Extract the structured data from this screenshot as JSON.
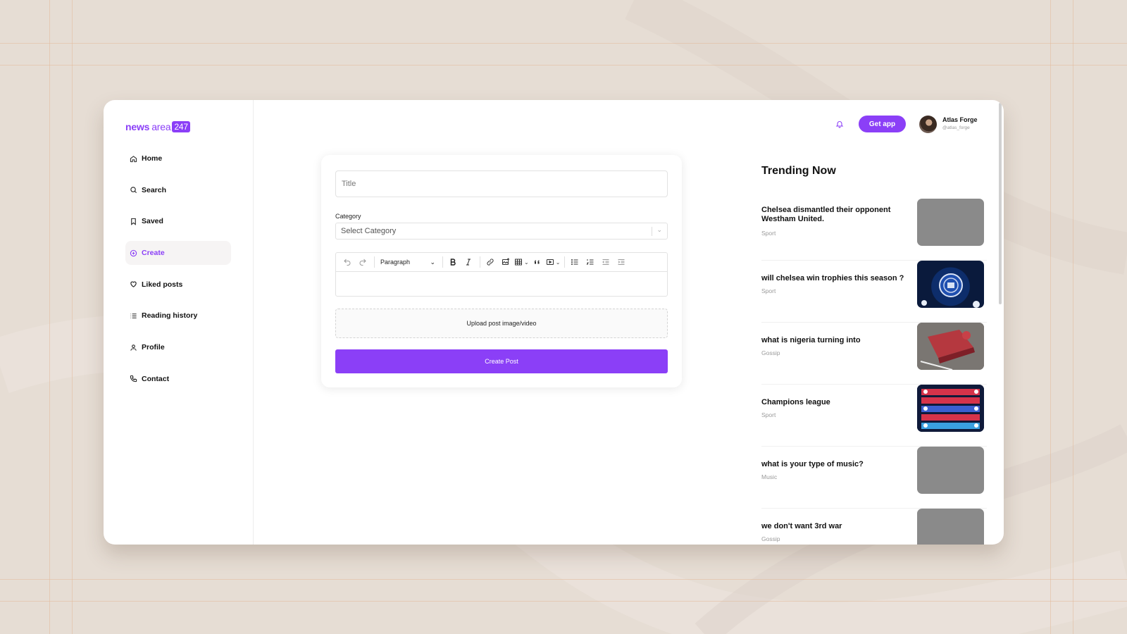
{
  "brand": {
    "part1": "news",
    "part2": "area",
    "badge": "247"
  },
  "nav": [
    {
      "label": "Home",
      "icon": "home-icon"
    },
    {
      "label": "Search",
      "icon": "search-icon"
    },
    {
      "label": "Saved",
      "icon": "bookmark-icon"
    },
    {
      "label": "Create",
      "icon": "plus-circle-icon",
      "active": true
    },
    {
      "label": "Liked posts",
      "icon": "heart-icon"
    },
    {
      "label": "Reading history",
      "icon": "list-icon"
    },
    {
      "label": "Profile",
      "icon": "user-icon"
    },
    {
      "label": "Contact",
      "icon": "phone-icon"
    }
  ],
  "topbar": {
    "get_app": "Get app",
    "user_name": "Atlas Forge",
    "user_handle": "@atlas_forge"
  },
  "form": {
    "title_placeholder": "Title",
    "category_label": "Category",
    "category_placeholder": "Select Category",
    "block_format": "Paragraph",
    "upload_label": "Upload post image/video",
    "submit_label": "Create Post"
  },
  "trending": {
    "title": "Trending Now",
    "items": [
      {
        "headline": "Chelsea dismantled their opponent Westham United.",
        "category": "Sport",
        "thumb": "placeholder"
      },
      {
        "headline": "will chelsea win trophies this season ?",
        "category": "Sport",
        "thumb": "chelsea-crest"
      },
      {
        "headline": "what is nigeria turning into",
        "category": "Gossip",
        "thumb": "red-table"
      },
      {
        "headline": "Champions league",
        "category": "Sport",
        "thumb": "league-table"
      },
      {
        "headline": "what is your type of music?",
        "category": "Music",
        "thumb": "placeholder"
      },
      {
        "headline": "we don't want 3rd war",
        "category": "Gossip",
        "thumb": "placeholder"
      }
    ]
  },
  "colors": {
    "accent": "#8b3ff7",
    "background": "#e6ddd4",
    "placeholder_thumb": "#8a8a8a"
  }
}
